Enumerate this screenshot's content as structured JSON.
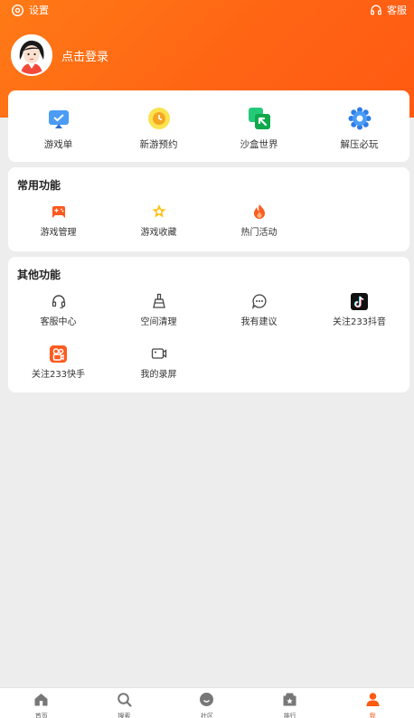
{
  "topbar": {
    "settings_label": "设置",
    "service_label": "客服"
  },
  "profile": {
    "login_text": "点击登录"
  },
  "quick_entries": [
    {
      "label": "游戏单",
      "icon": "game-list-icon"
    },
    {
      "label": "新游预约",
      "icon": "clock-icon"
    },
    {
      "label": "沙盒世界",
      "icon": "sandbox-arrow-icon"
    },
    {
      "label": "解压必玩",
      "icon": "gear-flower-icon"
    }
  ],
  "common": {
    "title": "常用功能",
    "items": [
      {
        "label": "游戏管理",
        "icon": "gamepad-icon"
      },
      {
        "label": "游戏收藏",
        "icon": "star-icon"
      },
      {
        "label": "热门活动",
        "icon": "fire-icon"
      }
    ]
  },
  "other": {
    "title": "其他功能",
    "items": [
      {
        "label": "客服中心",
        "icon": "headset-icon"
      },
      {
        "label": "空间清理",
        "icon": "broom-icon"
      },
      {
        "label": "我有建议",
        "icon": "chat-bubble-icon"
      },
      {
        "label": "关注233抖音",
        "icon": "tiktok-icon"
      },
      {
        "label": "关注233快手",
        "icon": "kuaishou-icon"
      },
      {
        "label": "我的录屏",
        "icon": "video-camera-icon"
      }
    ]
  },
  "bottom_nav": [
    {
      "label": "首页",
      "icon": "home-icon",
      "active": false
    },
    {
      "label": "搜索",
      "icon": "search-icon",
      "active": false
    },
    {
      "label": "社区",
      "icon": "community-icon",
      "active": false
    },
    {
      "label": "排行",
      "icon": "ranking-icon",
      "active": false
    },
    {
      "label": "我",
      "icon": "person-icon",
      "active": true
    }
  ],
  "colors": {
    "brand_orange": "#ff6414",
    "background": "#ededed",
    "card": "#ffffff"
  }
}
